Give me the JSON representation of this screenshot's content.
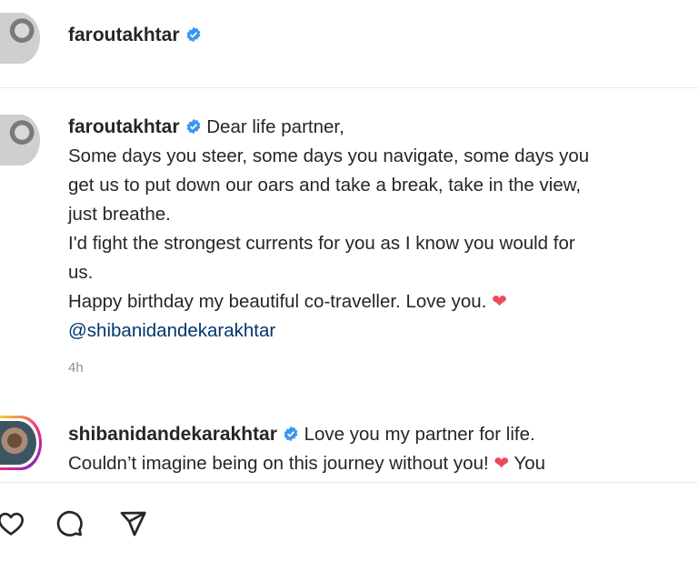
{
  "header": {
    "username": "faroutakhtar"
  },
  "comments": [
    {
      "username": "faroutakhtar",
      "lines": [
        "Dear life partner,",
        "Some days you steer, some days you navigate, some days you",
        "get us to put down our oars and take a break, take in the view,",
        "just breathe.",
        "I'd fight the strongest currents for you as I know you would for",
        "us.",
        "Happy birthday my beautiful co-traveller. Love you."
      ],
      "mention": "@shibanidandekarakhtar",
      "time": "4h"
    },
    {
      "username": "shibanidandekarakhtar",
      "lines": [
        "Love you my partner for life.",
        "Couldn’t imagine being on this journey without you!",
        "You"
      ]
    }
  ],
  "icons": [
    "verified-badge-icon",
    "heart-emoji-icon",
    "like-icon",
    "comment-icon",
    "share-icon"
  ],
  "colors": {
    "verified": "#3897f0",
    "heart": "#ed4956",
    "mention": "#00376b",
    "muted": "#8e8e8e"
  }
}
